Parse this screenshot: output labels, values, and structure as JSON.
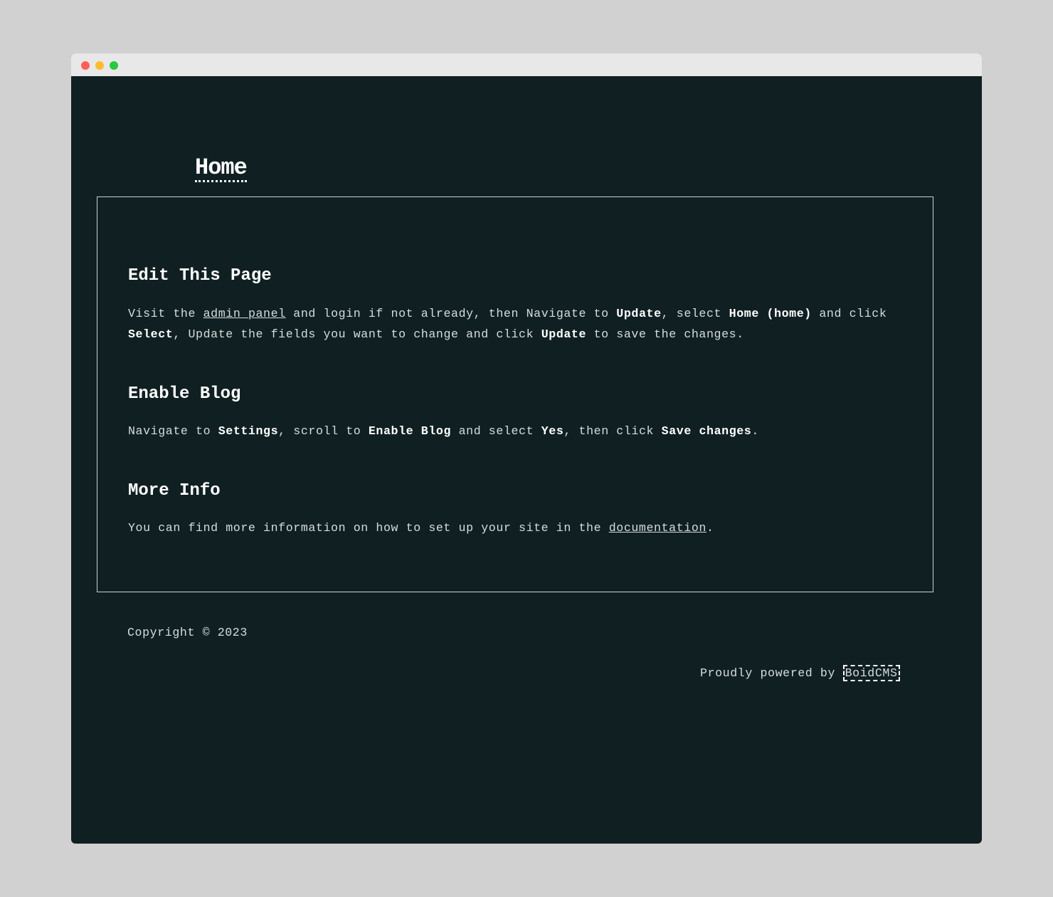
{
  "window": {
    "controls": [
      "close",
      "minimize",
      "maximize"
    ]
  },
  "site": {
    "title": "Home"
  },
  "sections": [
    {
      "heading": "Edit This Page",
      "parts": {
        "t1": "Visit the ",
        "link_admin": "admin panel",
        "t2": " and login if not already, then Navigate to ",
        "b_update": "Update",
        "t3": ", select ",
        "b_home": "Home (home)",
        "t4": " and click ",
        "b_select": "Select",
        "t5": ", Update the fields you want to change and click ",
        "b_update2": "Update",
        "t6": " to save the changes."
      }
    },
    {
      "heading": "Enable Blog",
      "parts": {
        "t1": "Navigate to ",
        "b_settings": "Settings",
        "t2": ", scroll to ",
        "b_enable_blog": "Enable Blog",
        "t3": " and select ",
        "b_yes": "Yes",
        "t4": ", then click ",
        "b_save": "Save changes",
        "t5": "."
      }
    },
    {
      "heading": "More Info",
      "parts": {
        "t1": "You can find more information on how to set up your site in the ",
        "link_docs": "documentation",
        "t2": "."
      }
    }
  ],
  "footer": {
    "copyright": "Copyright © 2023",
    "powered_prefix": "Proudly powered by ",
    "powered_link": "BoidCMS"
  },
  "colors": {
    "background": "#102022",
    "text": "#d6dcdc",
    "heading": "#ffffff",
    "desktop": "#d1d1d1",
    "titlebar": "#e8e8e8"
  }
}
